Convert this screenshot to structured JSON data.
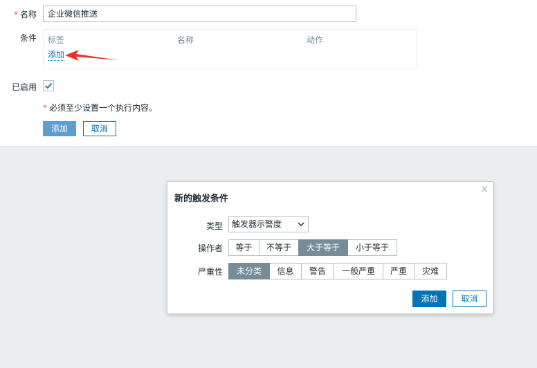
{
  "form": {
    "name_label": "名称",
    "name_value": "企业微信推送",
    "conditions_label": "条件",
    "conditions_table": {
      "headers": [
        "标签",
        "名称",
        "动作"
      ],
      "add_link": "添加"
    },
    "enabled_label": "已启用",
    "enabled_checked": true,
    "hint_star": "*",
    "hint_text": "必须至少设置一个执行内容。",
    "required_star": "*",
    "add_button": "添加",
    "cancel_button": "取消"
  },
  "dialog": {
    "title": "新的触发条件",
    "close": "×",
    "type_label": "类型",
    "type_value": "触发器示警度",
    "operator_label": "操作者",
    "operators": [
      "等于",
      "不等于",
      "大于等于",
      "小于等于"
    ],
    "operator_selected": "大于等于",
    "severity_label": "严重性",
    "severities": [
      "未分类",
      "信息",
      "警告",
      "一般严重",
      "严重",
      "灾难"
    ],
    "severity_selected": "未分类",
    "add_button": "添加",
    "cancel_button": "取消"
  },
  "colors": {
    "accent": "#0275b8",
    "segment_active": "#768d99",
    "arrow": "#e8312f",
    "required": "#e45959"
  }
}
